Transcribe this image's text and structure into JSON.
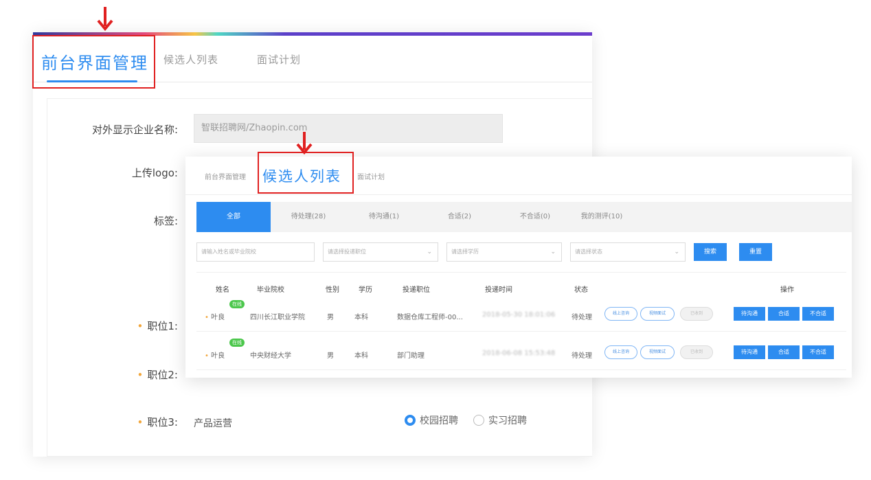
{
  "background": {
    "tabs": [
      "前台界面管理",
      "候选人列表",
      "面试计划"
    ],
    "form": {
      "company_label": "对外显示企业名称:",
      "company_value": "智联招聘网/Zhaopin.com",
      "logo_label": "上传logo:",
      "tags_label": "标签:",
      "position1_label": "职位1:",
      "position2_label": "职位2:",
      "position3_label": "职位3:",
      "position3_value": "产品运营",
      "radio_campus": "校园招聘",
      "radio_intern": "实习招聘"
    }
  },
  "foreground": {
    "tabs": [
      "前台界面管理",
      "候选人列表",
      "面试计划"
    ],
    "filter_tabs": [
      "全部",
      "待处理(28)",
      "待沟通(1)",
      "合适(2)",
      "不合适(0)",
      "我的测评(10)"
    ],
    "filters": {
      "name_placeholder": "请输入姓名或毕业院校",
      "position_placeholder": "请选择投递职位",
      "education_placeholder": "请选择学历",
      "status_placeholder": "请选择状态",
      "search_label": "搜索",
      "reset_label": "重置"
    },
    "table": {
      "headers": [
        "姓名",
        "毕业院校",
        "性别",
        "学历",
        "投递职位",
        "投递时间",
        "状态",
        "操作"
      ],
      "rows": [
        {
          "name": "叶良",
          "badge": "在线",
          "school": "四川长江职业学院",
          "gender": "男",
          "education": "本科",
          "position": "数据仓库工程师-00...",
          "time": "2018-05-30 18:01:06",
          "status": "待处理",
          "pills": [
            "线上咨询",
            "视频面试",
            "已收到"
          ],
          "ops": [
            "待沟通",
            "合适",
            "不合适"
          ]
        },
        {
          "name": "叶良",
          "badge": "在线",
          "school": "中央财经大学",
          "gender": "男",
          "education": "本科",
          "position": "部门助理",
          "time": "2018-06-08 15:53:48",
          "status": "待处理",
          "pills": [
            "线上咨询",
            "视频面试",
            "已收到"
          ],
          "ops": [
            "待沟通",
            "合适",
            "不合适"
          ]
        }
      ]
    }
  },
  "colors": {
    "accent": "#2d8cf0",
    "annotation": "#e02020",
    "online": "#4cc74c"
  }
}
